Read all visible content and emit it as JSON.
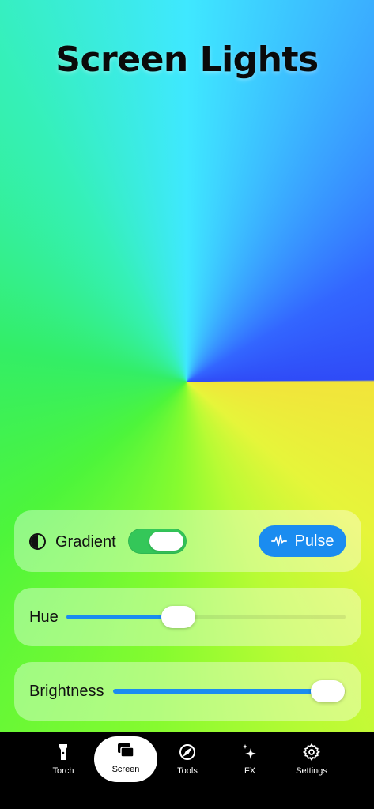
{
  "app": {
    "title": "Screen Lights"
  },
  "controls": {
    "gradient": {
      "label": "Gradient",
      "icon": "half-circle-icon",
      "enabled": true
    },
    "pulse": {
      "label": "Pulse",
      "icon": "waveform-icon"
    },
    "hue": {
      "label": "Hue",
      "value_fraction": 0.4
    },
    "brightness": {
      "label": "Brightness",
      "value_fraction": 0.92
    }
  },
  "colors": {
    "accent": "#1a8cf0",
    "toggle_on": "#34c759",
    "tabbar_bg": "#000000"
  },
  "tabs": [
    {
      "label": "Torch",
      "icon": "flashlight-icon",
      "active": false
    },
    {
      "label": "Screen",
      "icon": "screens-icon",
      "active": true
    },
    {
      "label": "Tools",
      "icon": "compass-icon",
      "active": false
    },
    {
      "label": "FX",
      "icon": "sparkles-icon",
      "active": false
    },
    {
      "label": "Settings",
      "icon": "gear-icon",
      "active": false
    }
  ]
}
